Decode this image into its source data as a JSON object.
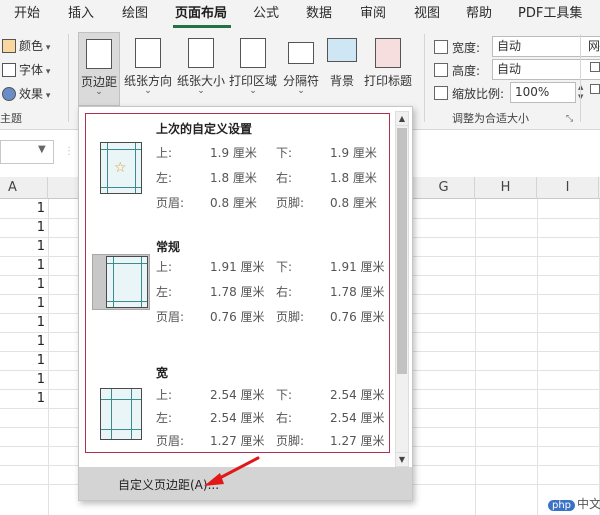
{
  "tabs": [
    {
      "label": "开始",
      "active": false
    },
    {
      "label": "插入",
      "active": false
    },
    {
      "label": "绘图",
      "active": false
    },
    {
      "label": "页面布局",
      "active": true
    },
    {
      "label": "公式",
      "active": false
    },
    {
      "label": "数据",
      "active": false
    },
    {
      "label": "审阅",
      "active": false
    },
    {
      "label": "视图",
      "active": false
    },
    {
      "label": "帮助",
      "active": false
    },
    {
      "label": "PDF工具集",
      "active": false
    }
  ],
  "ribbon": {
    "theme_items": [
      "颜色",
      "字体",
      "效果"
    ],
    "theme_group_label": "主题",
    "page_setup_buttons": [
      "页边距",
      "纸张方向",
      "纸张大小",
      "打印区域",
      "分隔符",
      "背景",
      "打印标题"
    ],
    "fit": {
      "width_label": "宽度:",
      "width_value": "自动",
      "height_label": "高度:",
      "height_value": "自动",
      "scale_label": "缩放比例:",
      "scale_value": "100%",
      "group_label": "调整为合适大小"
    },
    "cut_label": "网"
  },
  "sheet": {
    "columns": [
      "A",
      "G",
      "H",
      "I"
    ],
    "col_a_values": [
      "1",
      "1",
      "1",
      "1",
      "1",
      "1",
      "1",
      "1",
      "1",
      "1",
      "1"
    ]
  },
  "margins_menu": {
    "presets": [
      {
        "title": "上次的自定义设置",
        "rows": [
          [
            "上:",
            "1.9 厘米",
            "下:",
            "1.9 厘米"
          ],
          [
            "左:",
            "1.8 厘米",
            "右:",
            "1.8 厘米"
          ],
          [
            "页眉:",
            "0.8 厘米",
            "页脚:",
            "0.8 厘米"
          ]
        ]
      },
      {
        "title": "常规",
        "rows": [
          [
            "上:",
            "1.91 厘米",
            "下:",
            "1.91 厘米"
          ],
          [
            "左:",
            "1.78 厘米",
            "右:",
            "1.78 厘米"
          ],
          [
            "页眉:",
            "0.76 厘米",
            "页脚:",
            "0.76 厘米"
          ]
        ]
      },
      {
        "title": "宽",
        "rows": [
          [
            "上:",
            "2.54 厘米",
            "下:",
            "2.54 厘米"
          ],
          [
            "左:",
            "2.54 厘米",
            "右:",
            "2.54 厘米"
          ],
          [
            "页眉:",
            "1.27 厘米",
            "页脚:",
            "1.27 厘米"
          ]
        ]
      }
    ],
    "custom_label": "自定义页边距(A)..."
  },
  "watermark": {
    "badge": "php",
    "text": "中文网"
  }
}
